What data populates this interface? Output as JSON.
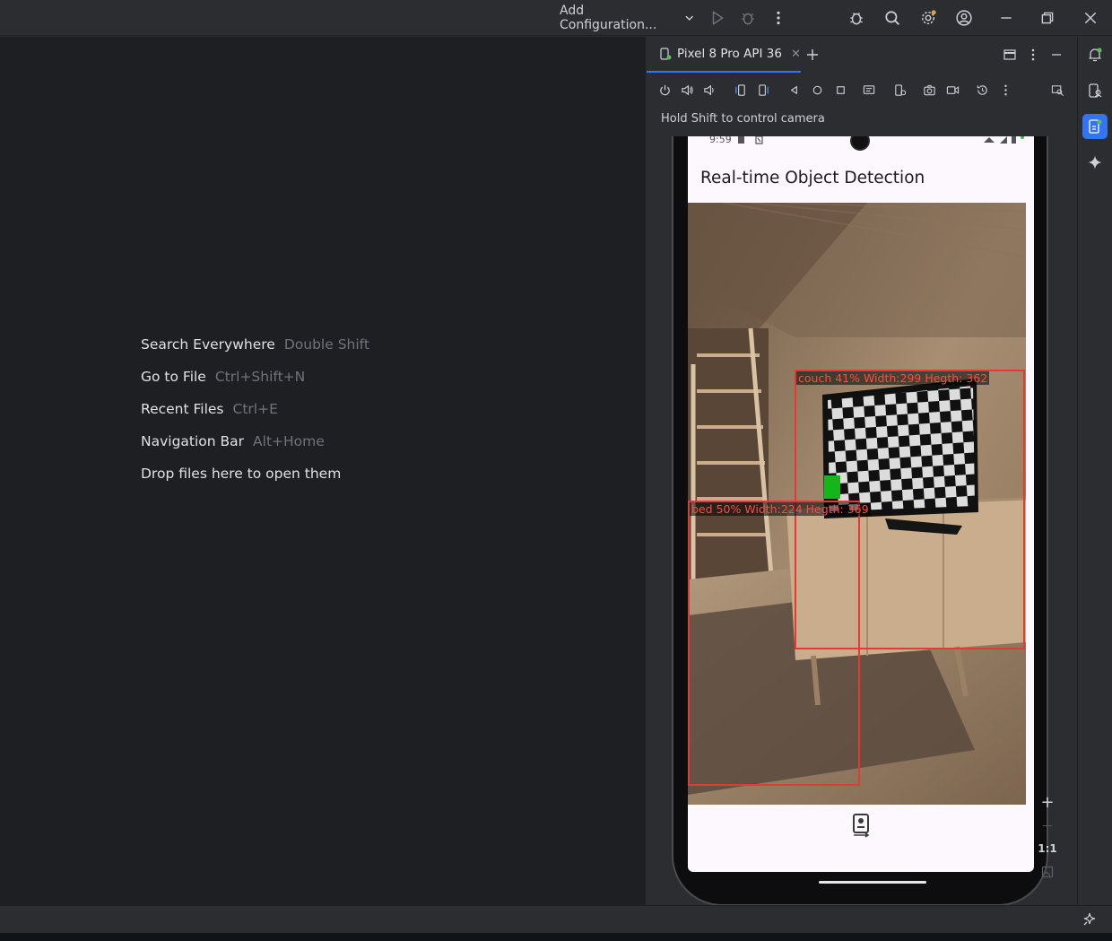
{
  "titlebar": {
    "run_config_label": "Add Configuration...",
    "icons": [
      "chevron-down-icon",
      "run-icon",
      "debug-icon",
      "more-icon",
      "bug-icon",
      "search-icon",
      "settings-icon",
      "account-icon",
      "minimize-icon",
      "restore-icon",
      "close-icon"
    ]
  },
  "editor": {
    "hints": [
      {
        "action": "Search Everywhere",
        "shortcut": "Double Shift"
      },
      {
        "action": "Go to File",
        "shortcut": "Ctrl+Shift+N"
      },
      {
        "action": "Recent Files",
        "shortcut": "Ctrl+E"
      },
      {
        "action": "Navigation Bar",
        "shortcut": "Alt+Home"
      },
      {
        "action": "Drop files here to open them",
        "shortcut": ""
      }
    ]
  },
  "running_devices": {
    "tab_label": "Pixel 8 Pro API 36",
    "camera_hint": "Hold Shift to control camera",
    "zoom": {
      "plus": "+",
      "minus": "—",
      "actual_size": "1:1"
    }
  },
  "device": {
    "status_time": "9:59",
    "app_title": "Real-time Object Detection",
    "detections": [
      {
        "label": "couch 41% Width:299 Hegth: 362",
        "color": "#e53935"
      },
      {
        "label": "bed 50% Width:224 Hegth: 369",
        "color": "#e53935"
      }
    ]
  },
  "colors": {
    "accent": "#3574f0",
    "box": "#e53935",
    "app_bg": "#fdf7fe",
    "editor_bg": "#1e1f22",
    "panel_bg": "#2b2d30"
  }
}
